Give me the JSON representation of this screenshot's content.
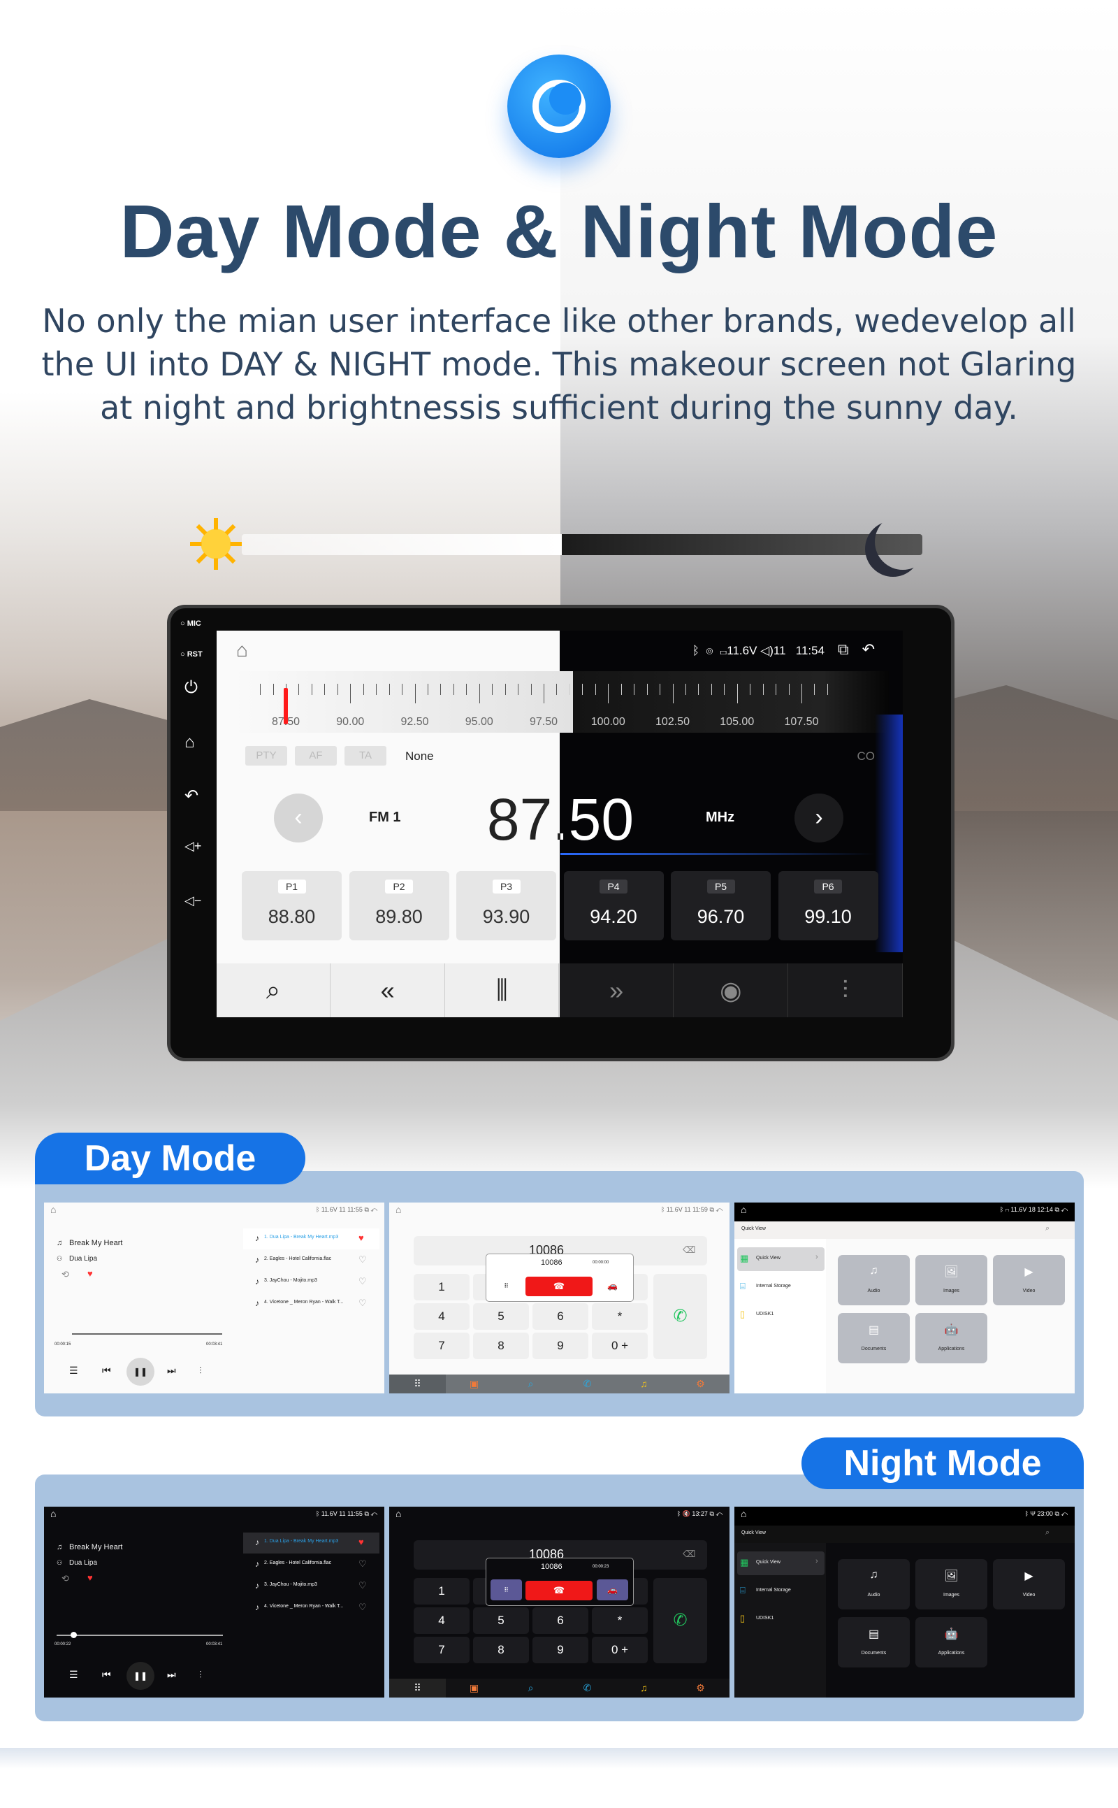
{
  "header": {
    "title": "Day Mode & Night Mode",
    "icon": "moon-icon",
    "description": [
      "No only the mian user interface like other brands, wedevelop all",
      "the UI into DAY & NIGHT mode. This makeour screen not Glaring",
      "at night and brightnessis sufficient during the sunny day."
    ]
  },
  "head_unit": {
    "side_labels": [
      "MIC",
      "RST"
    ],
    "status": {
      "voltage": "11.6V",
      "volume": "11",
      "time": "11:54"
    },
    "scale_labels": [
      "87.50",
      "90.00",
      "92.50",
      "95.00",
      "97.50",
      "100.00",
      "102.50",
      "105.00",
      "107.50"
    ],
    "rds": {
      "pty": "PTY",
      "af": "AF",
      "ta": "TA",
      "value": "None"
    },
    "band": "FM 1",
    "frequency": "87.50",
    "unit": "MHz",
    "presets": [
      {
        "label": "P1",
        "value": "88.80"
      },
      {
        "label": "P2",
        "value": "89.80"
      },
      {
        "label": "P3",
        "value": "93.90"
      },
      {
        "label": "P4",
        "value": "94.20"
      },
      {
        "label": "P5",
        "value": "96.70"
      },
      {
        "label": "P6",
        "value": "99.10"
      }
    ],
    "accent": "#ff1a1a"
  },
  "day_mode": {
    "label": "Day Mode",
    "music": {
      "status": "11.6V  11   11:55",
      "song": "Break My Heart",
      "artist": "Dua Lipa",
      "elapsed": "00:00:15",
      "total": "00:03:41",
      "progress": 0.07,
      "playlist": [
        "1.  Dua Lipa - Break My Heart.mp3",
        "2.  Eagles - Hotel California.flac",
        "3.  JayChou - Mojito.mp3",
        "4.  Vicetone _ Meron Ryan - Walk T..."
      ]
    },
    "dialer": {
      "status": "11.6V  11   11:59",
      "number": "10086",
      "call_number": "10086",
      "call_timer": "00:00:00",
      "keys": [
        "1",
        "",
        "",
        "",
        "4",
        "5",
        "6",
        "*",
        "7",
        "8",
        "9",
        "0 +"
      ]
    },
    "files": {
      "status": "11.6V  18   12:14",
      "header": "Quick View",
      "sidebar": [
        "Quick View",
        "Internal Storage",
        "UDISK1"
      ],
      "tiles": [
        "Audio",
        "Images",
        "Video",
        "Documents",
        "Applications"
      ]
    }
  },
  "night_mode": {
    "label": "Night Mode",
    "music": {
      "status": "11.6V  11   11:55",
      "song": "Break My Heart",
      "artist": "Dua Lipa",
      "elapsed": "00:00:22",
      "total": "00:03:41",
      "progress": 0.1,
      "playlist": [
        "1.  Dua Lipa - Break My Heart.mp3",
        "2.  Eagles - Hotel California.flac",
        "3.  JayChou - Mojito.mp3",
        "4.  Vicetone _ Meron Ryan - Walk T..."
      ]
    },
    "dialer": {
      "status": "13:27",
      "number": "10086",
      "call_number": "10086",
      "call_timer": "00:00:23",
      "keys": [
        "1",
        "",
        "",
        "#",
        "4",
        "5",
        "6",
        "*",
        "7",
        "8",
        "9",
        "0 +"
      ]
    },
    "files": {
      "status": "23:00",
      "header": "Quick View",
      "sidebar": [
        "Quick View",
        "Internal Storage",
        "UDISK1"
      ],
      "tiles": [
        "Audio",
        "Images",
        "Video",
        "Documents",
        "Applications"
      ]
    }
  },
  "colors": {
    "brand_blue": "#1673e6",
    "panel": "#a9c3e0",
    "title": "#2c4a6b",
    "hangup": "#f01818",
    "call": "#22c55e"
  }
}
